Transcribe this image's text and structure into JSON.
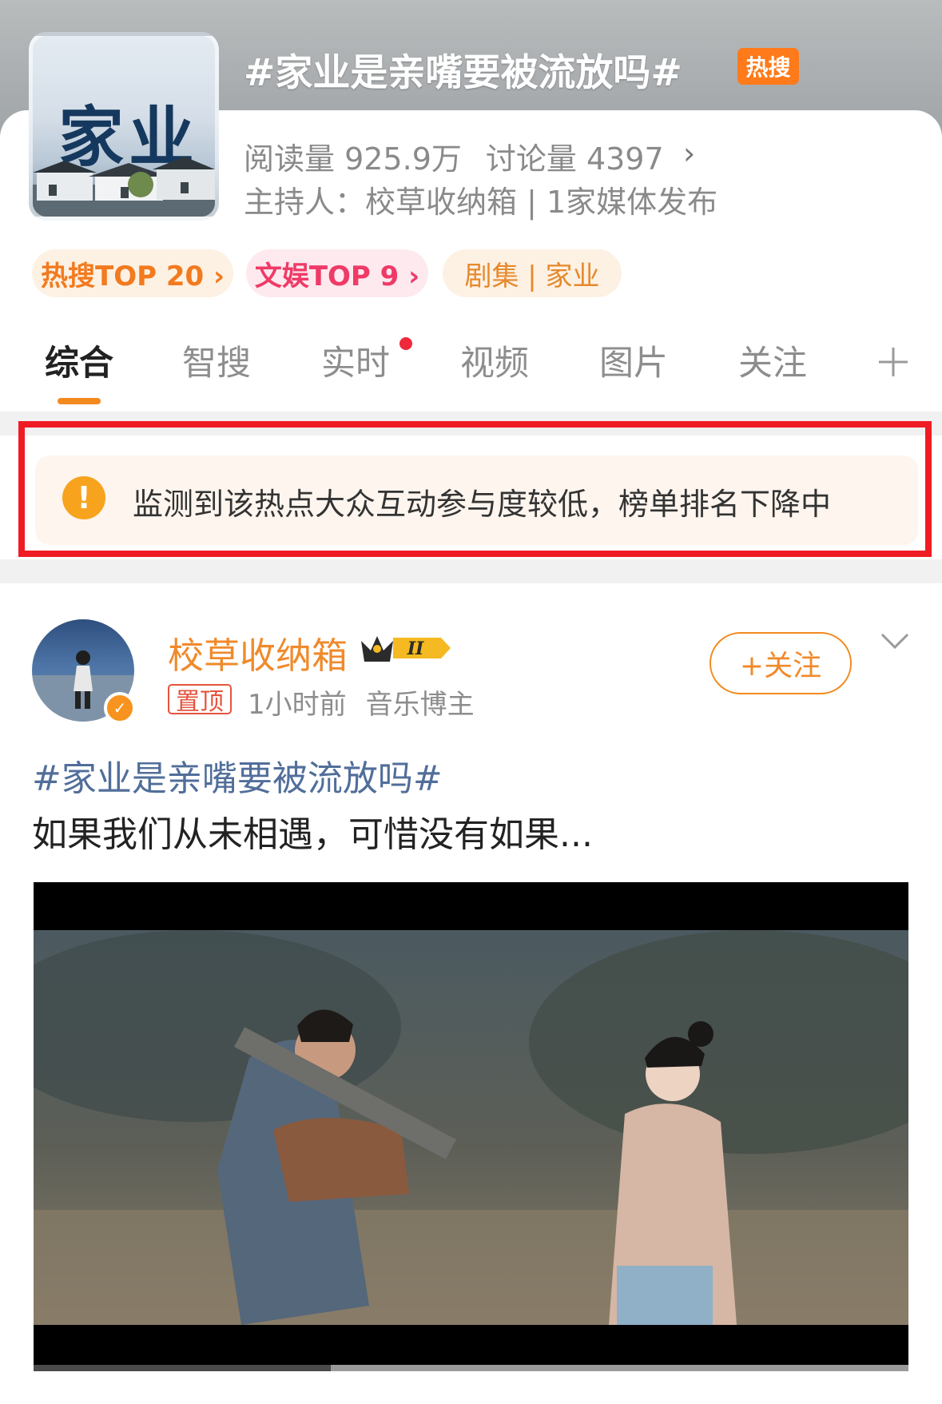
{
  "topic": {
    "thumbnail_text": "家业",
    "title": "#家业是亲嘴要被流放吗#",
    "hot_badge": "热搜",
    "reads": "阅读量 925.9万",
    "discussions": "讨论量 4397",
    "host": "主持人：校草收纳箱 | 1家媒体发布",
    "chips": {
      "hot_rank": "热搜TOP 20 ›",
      "ent_rank": "文娱TOP 9 ›",
      "drama": "剧集 | 家业"
    }
  },
  "tabs": [
    {
      "label": "综合",
      "active": true
    },
    {
      "label": "智搜"
    },
    {
      "label": "实时",
      "has_dot": true
    },
    {
      "label": "视频"
    },
    {
      "label": "图片"
    },
    {
      "label": "关注"
    }
  ],
  "notice": {
    "text": "监测到该热点大众互动参与度较低，榜单排名下降中",
    "icon": "warning-icon"
  },
  "post": {
    "author": "校草收纳箱",
    "level_badge": "II",
    "pinned_label": "置顶",
    "time": "1小时前",
    "author_type": "音乐博主",
    "follow_label": "+关注",
    "hashtag": "#家业是亲嘴要被流放吗#",
    "text": "如果我们从未相遇，可惜没有如果...",
    "video_progress_fraction": 0.34
  },
  "colors": {
    "accent": "#f28a1f",
    "highlight_red": "#ef1c24",
    "link_blue": "#516e9a"
  }
}
